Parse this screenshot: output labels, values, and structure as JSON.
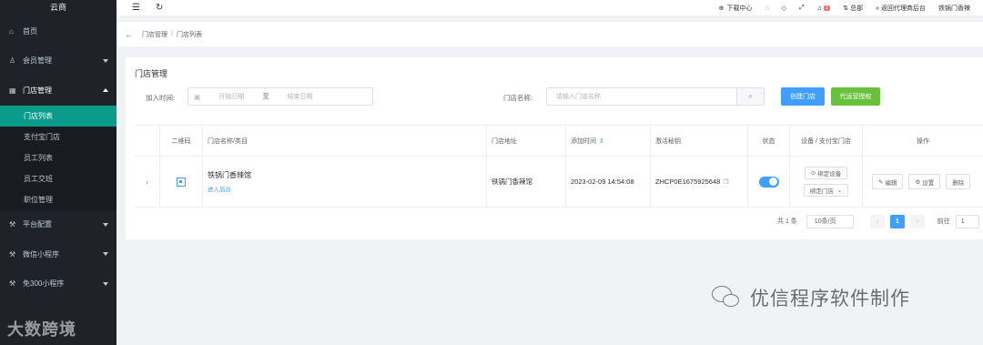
{
  "brand": "云商",
  "sidebar": {
    "items": [
      {
        "icon": "⌂",
        "label": "首页",
        "caret": false
      },
      {
        "icon": "♙",
        "label": "会员管理",
        "caret": true
      },
      {
        "icon": "▦",
        "label": "门店管理",
        "caret": true,
        "open": true
      }
    ],
    "subitems": [
      "门店列表",
      "支付宝门店",
      "员工列表",
      "员工交班",
      "职位管理"
    ],
    "more": [
      {
        "icon": "⚒",
        "label": "平台配置"
      },
      {
        "icon": "⚒",
        "label": "微信小程序"
      },
      {
        "icon": "⚒",
        "label": "免300小程序"
      }
    ]
  },
  "topbar": {
    "download": "下载中心",
    "notice_count": "2",
    "hq": "总部",
    "back_agent": "返回代理商后台",
    "user": "铁锅门香辣"
  },
  "breadcrumb": [
    "门店管理",
    "门店列表"
  ],
  "page_title": "门店管理",
  "filters": {
    "add_time_label": "加入时间:",
    "date_start": "开始日期",
    "date_to": "至",
    "date_end": "结束日期",
    "store_name_label": "门店名称:",
    "store_name_placeholder": "请输入门店名称"
  },
  "buttons": {
    "create_store": "创建门店",
    "agent_auth": "代运营授权"
  },
  "table": {
    "headers": [
      "二维码",
      "门店名称/类目",
      "门店地址",
      "添加时间",
      "激活秘钥",
      "状态",
      "设备 / 支付宝门店",
      "操作"
    ],
    "rows": [
      {
        "store_name": "铁锅门香辣馆",
        "enter_backend": "进入后台",
        "address": "铁锅门香辣馆",
        "added_time": "2023-02-09 14:54:08",
        "activation_key": "ZHCP0E1675925648",
        "status_on": true,
        "bind_device": "绑定设备",
        "bind_store": "绑定门店",
        "edit": "编辑",
        "settings": "设置",
        "delete": "删除"
      }
    ]
  },
  "pagination": {
    "total": "共 1 条",
    "page_size": "10条/页",
    "current_page": "1",
    "goto": "前往",
    "goto_value": "1"
  },
  "watermarks": {
    "left": "大数跨境",
    "right": "优信程序软件制作"
  }
}
